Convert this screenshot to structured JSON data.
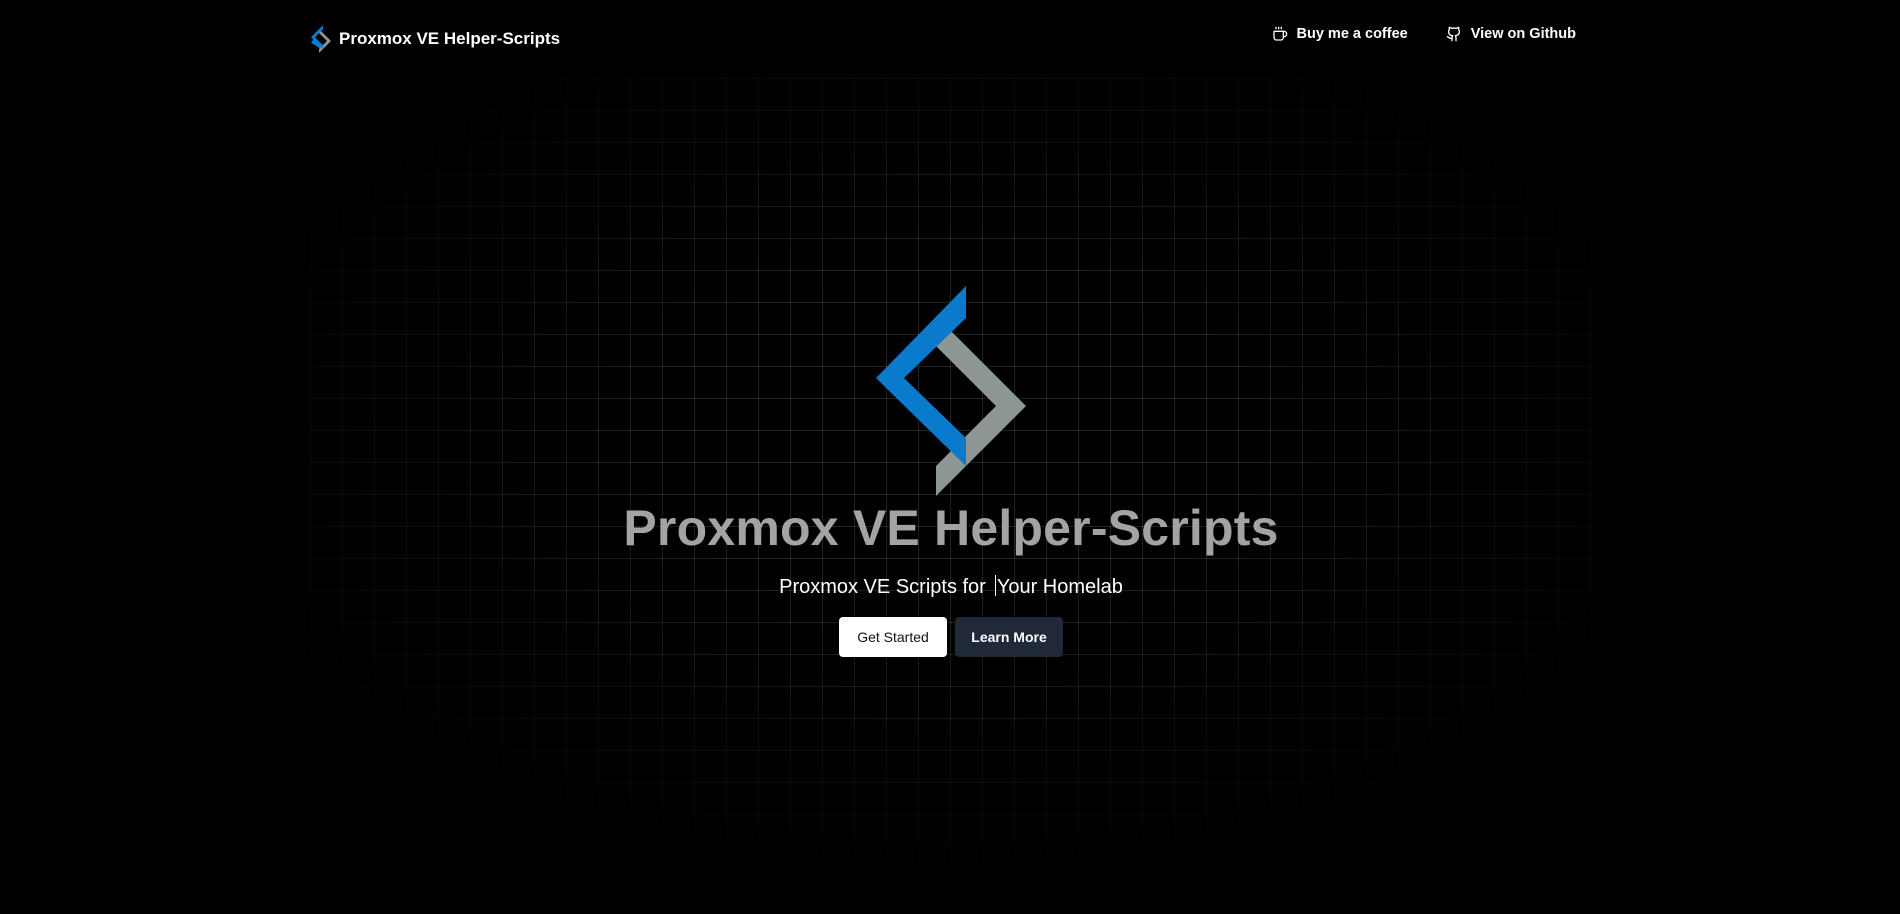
{
  "header": {
    "brand": {
      "logo_icon": "proxmox-helper-scripts-logo",
      "title": "Proxmox VE Helper-Scripts"
    },
    "links": [
      {
        "icon": "coffee-cup-icon",
        "label": "Buy me a coffee"
      },
      {
        "icon": "github-icon",
        "label": "View on Github"
      }
    ]
  },
  "hero": {
    "logo_icon": "proxmox-helper-scripts-logo",
    "title": "Proxmox VE Helper-Scripts",
    "subtitle_prefix": "Proxmox VE Scripts for",
    "subtitle_typed": "Your Homelab",
    "buttons": {
      "primary_label": "Get Started",
      "secondary_label": "Learn More"
    }
  },
  "colors": {
    "background": "#000000",
    "logo_blue": "#0a7bcc",
    "logo_gray": "#8e9595",
    "title_gray": "#a3a3a3",
    "secondary_button": "#1f2937"
  }
}
